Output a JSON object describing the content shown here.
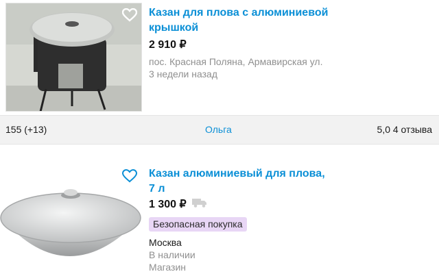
{
  "listings": [
    {
      "title_line1": "Казан для плова с алюминиевой",
      "title_line2": "крышкой",
      "price": "2 910 ₽",
      "address": "пос. Красная Поляна, Армавирская ул.",
      "date": "3 недели назад",
      "favorite_icon": "heart-outline-icon"
    },
    {
      "title_line1": "Казан алюминиевый для плова,",
      "title_line2": "7 л",
      "price": "1 300 ₽",
      "delivery_icon": "truck-icon",
      "badge": "Безопасная покупка",
      "city": "Москва",
      "stock": "В наличии",
      "seller_type": "Магазин",
      "favorite_icon": "heart-outline-icon"
    }
  ],
  "seller_bar": {
    "views": "155 (+13)",
    "seller_name": "Ольга",
    "rating": "5,0 4 отзыва"
  },
  "colors": {
    "link": "#0a8fd6",
    "badge_bg": "#e8d6f5",
    "bar_bg": "#f2f2f2",
    "muted": "#8f8f8f"
  }
}
